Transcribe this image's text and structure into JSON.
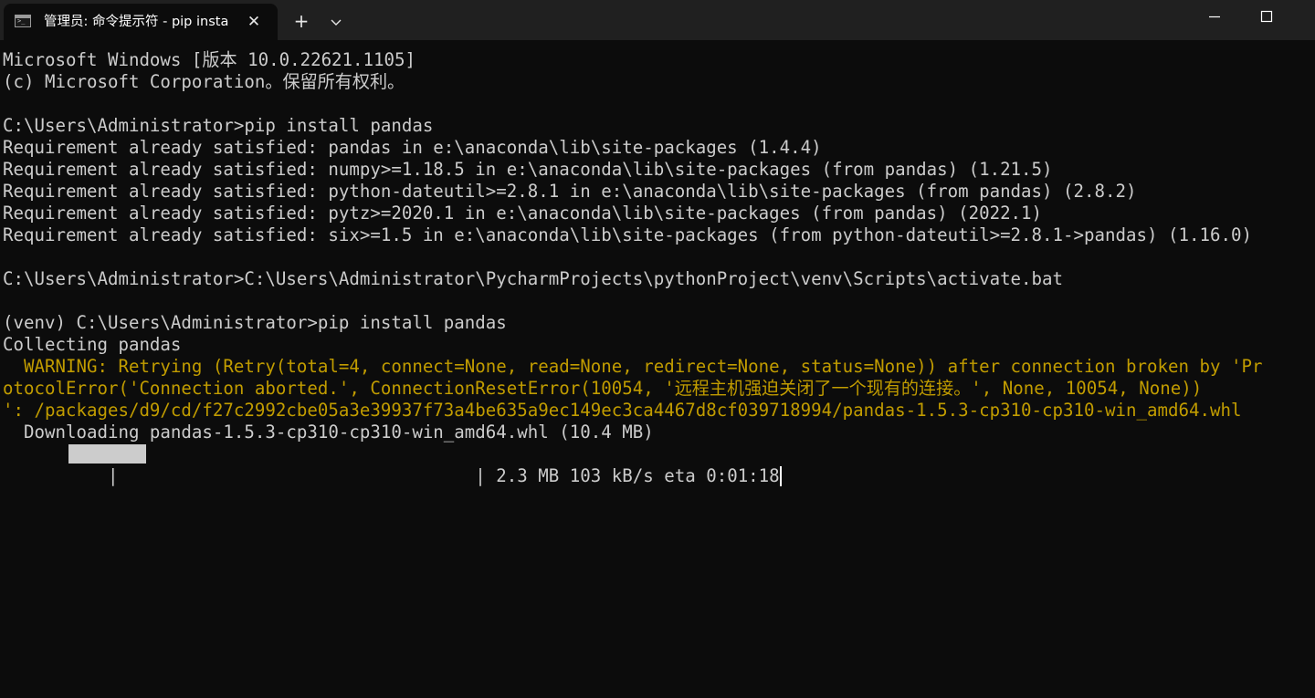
{
  "window": {
    "tab_title": "管理员: 命令提示符 - pip  insta",
    "close_label": "✕",
    "new_tab_label": "+"
  },
  "terminal": {
    "lines": [
      {
        "text": "Microsoft Windows [版本 10.0.22621.1105]",
        "color": "#cccccc"
      },
      {
        "text": "(c) Microsoft Corporation。保留所有权利。",
        "color": "#cccccc"
      },
      {
        "text": "",
        "color": "#cccccc"
      },
      {
        "text": "C:\\Users\\Administrator>pip install pandas",
        "color": "#cccccc"
      },
      {
        "text": "Requirement already satisfied: pandas in e:\\anaconda\\lib\\site-packages (1.4.4)",
        "color": "#cccccc"
      },
      {
        "text": "Requirement already satisfied: numpy>=1.18.5 in e:\\anaconda\\lib\\site-packages (from pandas) (1.21.5)",
        "color": "#cccccc"
      },
      {
        "text": "Requirement already satisfied: python-dateutil>=2.8.1 in e:\\anaconda\\lib\\site-packages (from pandas) (2.8.2)",
        "color": "#cccccc"
      },
      {
        "text": "Requirement already satisfied: pytz>=2020.1 in e:\\anaconda\\lib\\site-packages (from pandas) (2022.1)",
        "color": "#cccccc"
      },
      {
        "text": "Requirement already satisfied: six>=1.5 in e:\\anaconda\\lib\\site-packages (from python-dateutil>=2.8.1->pandas) (1.16.0)",
        "color": "#cccccc"
      },
      {
        "text": "",
        "color": "#cccccc"
      },
      {
        "text": "C:\\Users\\Administrator>C:\\Users\\Administrator\\PycharmProjects\\pythonProject\\venv\\Scripts\\activate.bat",
        "color": "#cccccc"
      },
      {
        "text": "",
        "color": "#cccccc"
      },
      {
        "text": "(venv) C:\\Users\\Administrator>pip install pandas",
        "color": "#cccccc"
      },
      {
        "text": "Collecting pandas",
        "color": "#cccccc"
      },
      {
        "text": "  WARNING: Retrying (Retry(total=4, connect=None, read=None, redirect=None, status=None)) after connection broken by 'Pr",
        "color": "#c19c00"
      },
      {
        "text": "otocolError('Connection aborted.', ConnectionResetError(10054, '远程主机强迫关闭了一个现有的连接。', None, 10054, None))",
        "color": "#c19c00"
      },
      {
        "text": "': /packages/d9/cd/f27c2992cbe05a3e39937f73a4be635a9ec149ec3ca4467d8cf039718994/pandas-1.5.3-cp310-cp310-win_amd64.whl",
        "color": "#c19c00"
      },
      {
        "text": "  Downloading pandas-1.5.3-cp310-cp310-win_amd64.whl (10.4 MB)",
        "color": "#cccccc"
      }
    ],
    "progress": {
      "fraction": 0.22,
      "stats_text": "2.3 MB 103 kB/s eta 0:01:18",
      "bar_color": "#cccccc"
    }
  }
}
